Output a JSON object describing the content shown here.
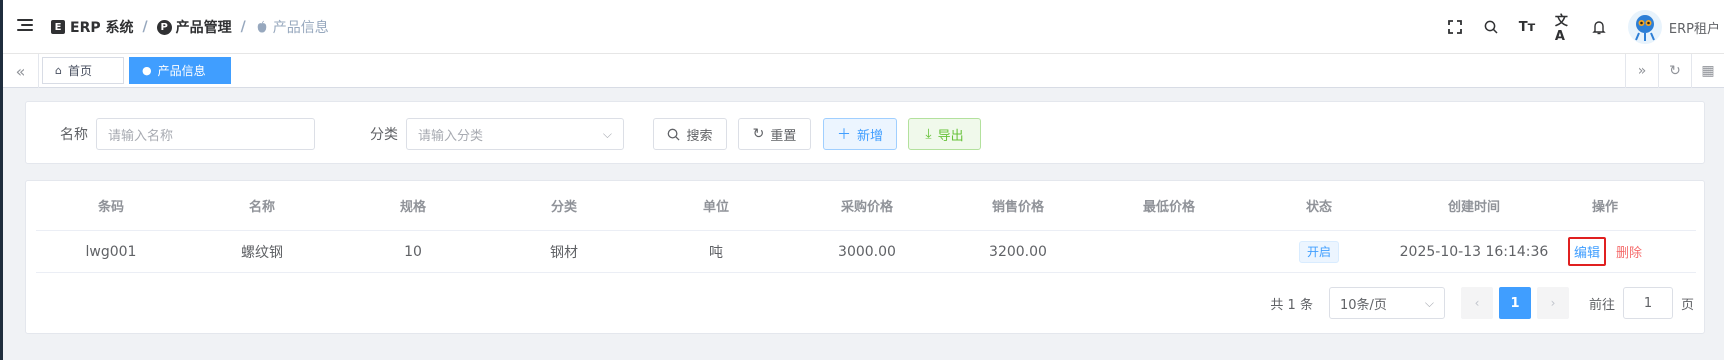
{
  "breadcrumb": {
    "items": [
      {
        "label": "ERP 系统"
      },
      {
        "label": "产品管理"
      },
      {
        "label": "产品信息"
      }
    ],
    "separator": "/"
  },
  "user": {
    "name": "ERP租户"
  },
  "tags": {
    "home": "首页",
    "active": "产品信息"
  },
  "search": {
    "name_label": "名称",
    "name_placeholder": "请输入名称",
    "category_label": "分类",
    "category_placeholder": "请输入分类",
    "search_btn": "搜索",
    "reset_btn": "重置",
    "add_btn": "新增",
    "export_btn": "导出"
  },
  "table": {
    "columns": [
      "条码",
      "名称",
      "规格",
      "分类",
      "单位",
      "采购价格",
      "销售价格",
      "最低价格",
      "状态",
      "创建时间",
      "操作"
    ],
    "rows": [
      {
        "barcode": "lwg001",
        "name": "螺纹钢",
        "spec": "10",
        "category": "钢材",
        "unit": "吨",
        "purchase_price": "3000.00",
        "sale_price": "3200.00",
        "min_price": "",
        "status": "开启",
        "created": "2025-10-13 16:14:36",
        "edit": "编辑",
        "delete": "删除"
      }
    ]
  },
  "pagination": {
    "total": "共 1 条",
    "page_size": "10条/页",
    "current": "1",
    "goto_label": "前往",
    "goto_value": "1",
    "page_suffix": "页"
  },
  "colors": {
    "primary": "#409eff",
    "danger": "#f56c6c",
    "success": "#67c23a"
  }
}
